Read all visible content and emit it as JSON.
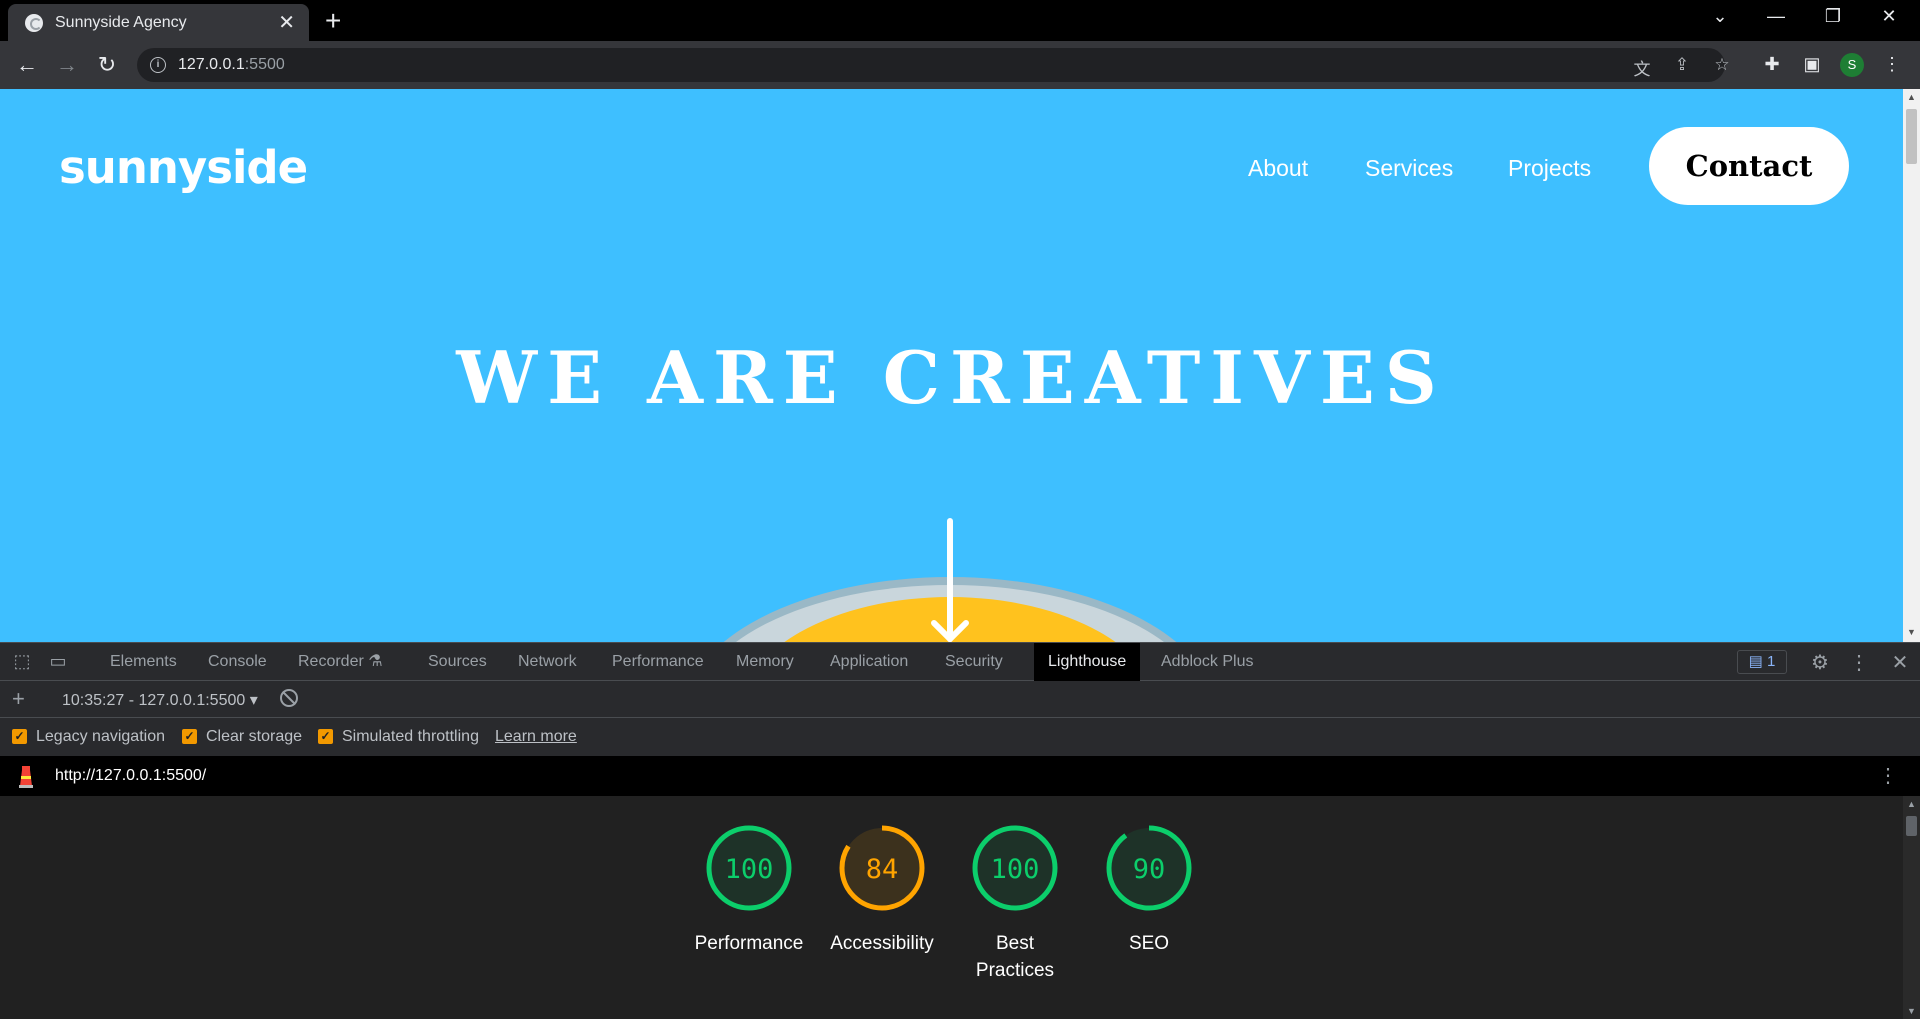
{
  "browser": {
    "tab_title": "Sunnyside Agency",
    "url_host": "127.0.0.1",
    "url_port": ":5500",
    "profile_initial": "S"
  },
  "site": {
    "logo": "sunnyside",
    "nav": [
      "About",
      "Services",
      "Projects"
    ],
    "contact": "Contact",
    "hero_title": "WE ARE CREATIVES",
    "colors": {
      "hero_bg": "#3ebfff",
      "yolk": "#ffc21e"
    }
  },
  "devtools": {
    "tabs": [
      "Elements",
      "Console",
      "Recorder",
      "Sources",
      "Network",
      "Performance",
      "Memory",
      "Application",
      "Security",
      "Lighthouse",
      "Adblock Plus"
    ],
    "active_tab": "Lighthouse",
    "issues_count": "1",
    "lighthouse": {
      "report_select": "10:35:27 - 127.0.0.1:5500",
      "options": [
        "Legacy navigation",
        "Clear storage",
        "Simulated throttling"
      ],
      "learn_more": "Learn more",
      "url": "http://127.0.0.1:5500/",
      "scores": [
        {
          "label": "Performance",
          "value": 100,
          "color": "#0cce6b"
        },
        {
          "label": "Accessibility",
          "value": 84,
          "color": "#ffa400"
        },
        {
          "label": "Best Practices",
          "value": 100,
          "color": "#0cce6b"
        },
        {
          "label": "SEO",
          "value": 90,
          "color": "#0cce6b"
        }
      ]
    }
  }
}
